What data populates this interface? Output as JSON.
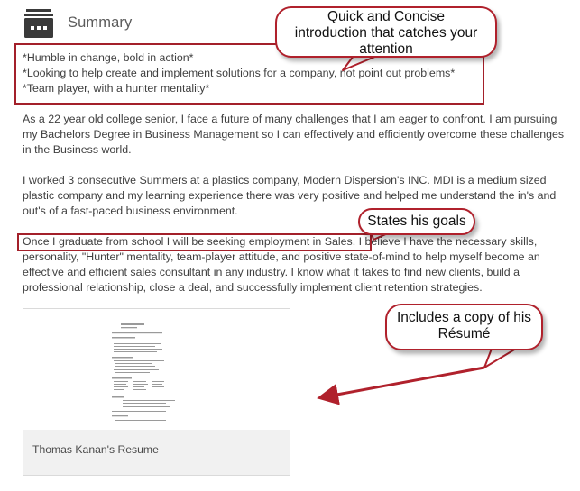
{
  "section": {
    "icon": "briefcase-icon",
    "title": "Summary"
  },
  "headline_lines": [
    "*Humble in change, bold in action*",
    "*Looking to help create and implement solutions for a company, not point out problems*",
    "*Team player, with a hunter mentality*"
  ],
  "paragraphs": {
    "p1": "As a 22 year old college senior, I face a future of many challenges that I am eager to confront. I am pursuing my Bachelors Degree in Business Management so I can effectively and efficiently overcome these challenges in the Business world.",
    "p2": "I worked 3 consecutive Summers at a plastics company, Modern Dispersion's INC. MDI is a medium sized plastic company and my learning experience there was very positive and helped me understand the in's and out's of a fast-paced business environment.",
    "p3_goal": "Once I graduate from school I will be seeking employment in Sales",
    "p3_rest": ". I believe I have the necessary skills, personality, \"Hunter\" mentality, team-player attitude, and positive state-of-mind to help myself become an effective and efficient sales consultant in any industry. I know what it takes to find new clients, build a professional relationship, close a deal, and successfully implement client retention strategies."
  },
  "callouts": {
    "intro": [
      "Quick and Concise",
      "introduction that catches your",
      "attention"
    ],
    "goals": [
      "States his goals"
    ],
    "resume": [
      "Includes a copy of his",
      "Résumé"
    ]
  },
  "attachment": {
    "caption": "Thomas Kanan's Resume",
    "thumbnail_icon": "document-thumbnail"
  },
  "colors": {
    "annotation_red": "#a3202a",
    "body_text": "#3f3f3f",
    "caption_bar": "#f1f1f1"
  }
}
